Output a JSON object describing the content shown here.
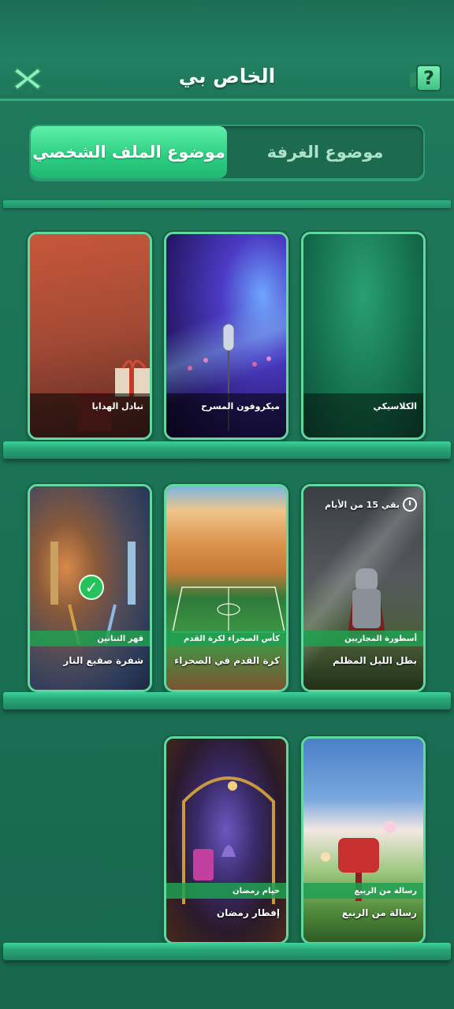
{
  "header": {
    "title": "الخاص بي",
    "close_icon": "close-icon",
    "help_icon": "help-icon",
    "help_glyph": "?"
  },
  "tabs": [
    {
      "label": "موضوع الغرفة",
      "active": false
    },
    {
      "label": "موضوع الملف الشخصي",
      "active": true
    }
  ],
  "themes": [
    {
      "name": "الكلاسيكي"
    },
    {
      "name": "ميكروفون المسرح"
    },
    {
      "name": "تبادل الهدايا"
    },
    {
      "name": "بطل الليل المظلم",
      "tag": "أسطورة المجاريين",
      "countdown": "بقي 15 من الأيام"
    },
    {
      "name": "كرة القدم في الصحراء",
      "tag": "كأس الصحراء لكرة القدم"
    },
    {
      "name": "شفرة صقيع النار",
      "tag": "قهر التنانين",
      "selected": true
    },
    {
      "name": "رسالة من الربيع",
      "tag": "رسالة من الربيع"
    },
    {
      "name": "إفطار رمضان",
      "tag": "خيام رمضان"
    }
  ],
  "colors": {
    "accent": "#2ed084",
    "background": "#1c7356"
  }
}
